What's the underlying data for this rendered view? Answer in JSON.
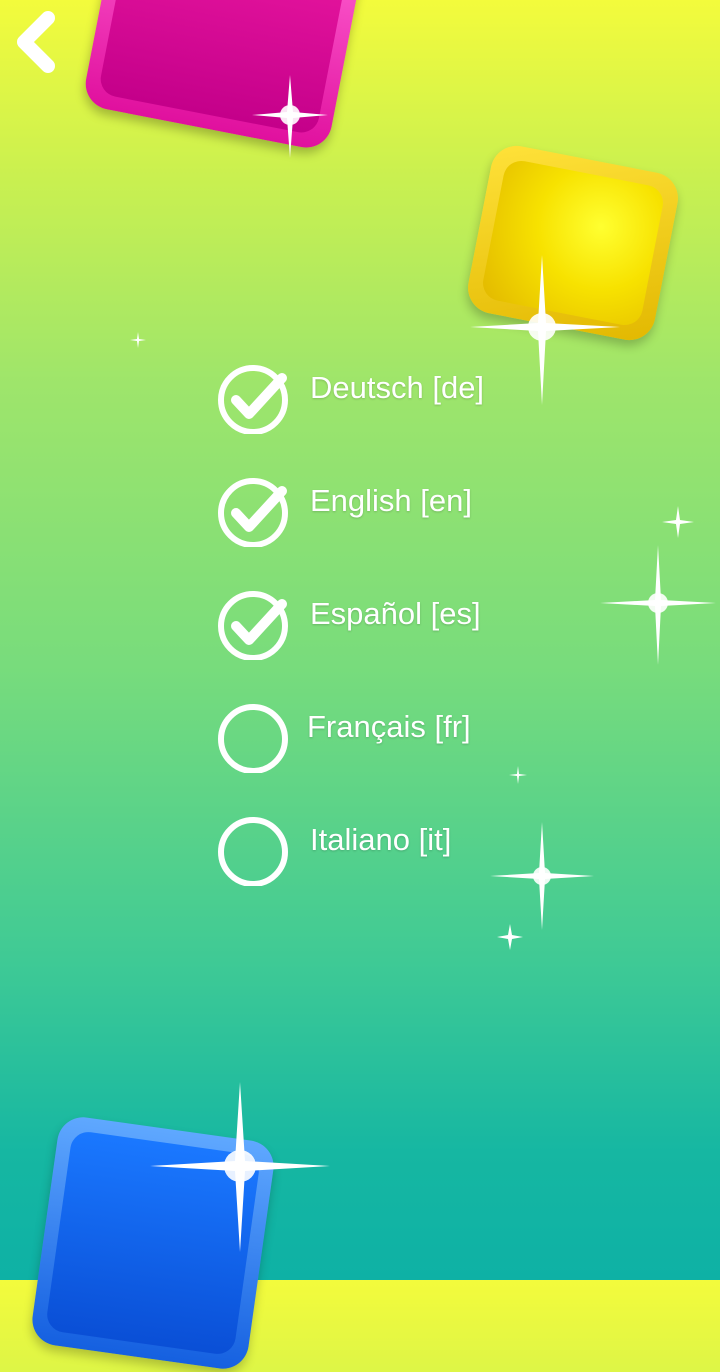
{
  "languages": [
    {
      "label": "Deutsch [de]",
      "checked": true
    },
    {
      "label": "English [en]",
      "checked": true
    },
    {
      "label": "Español [es]",
      "checked": true
    },
    {
      "label": "Français [fr]",
      "checked": false
    },
    {
      "label": "Italiano [it]",
      "checked": false
    }
  ],
  "icons": {
    "back": "chevron-left-icon",
    "checked": "check-circle-icon",
    "unchecked": "empty-circle-icon"
  },
  "colors": {
    "gradient_top": "#f3fb3c",
    "gradient_bottom": "#0eb1a5",
    "pink_gem": "#e0109e",
    "yellow_gem": "#f7e200",
    "blue_gem": "#1560e0",
    "text": "#ffffff"
  }
}
